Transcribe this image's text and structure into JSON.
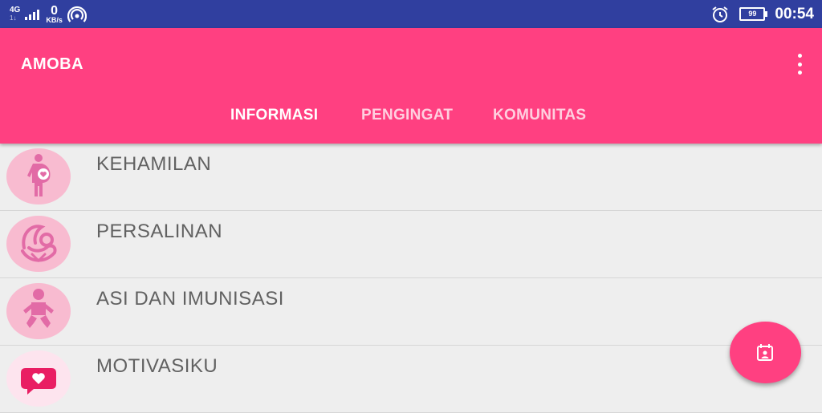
{
  "status_bar": {
    "network_type": "4G",
    "network_sub": "1↓",
    "speed_value": "0",
    "speed_unit": "KB/s",
    "battery": "99",
    "time": "00:54"
  },
  "app_bar": {
    "title": "AMOBA",
    "menu_icon": "more-vert-icon"
  },
  "tabs": [
    {
      "label": "INFORMASI",
      "active": true
    },
    {
      "label": "PENGINGAT",
      "active": false
    },
    {
      "label": "KOMUNITAS",
      "active": false
    }
  ],
  "list": [
    {
      "label": "KEHAMILAN",
      "icon": "pregnant-woman-icon"
    },
    {
      "label": "PERSALINAN",
      "icon": "mother-baby-icon"
    },
    {
      "label": "ASI DAN IMUNISASI",
      "icon": "baby-icon"
    },
    {
      "label": "MOTIVASIKU",
      "icon": "heart-chat-icon"
    }
  ],
  "fab": {
    "icon": "calendar-person-icon"
  },
  "colors": {
    "status_bar": "#303f9f",
    "accent": "#ff4081",
    "avatar_bg": "#f8bbd0",
    "icon_pink": "#e26ba6",
    "list_text": "#616161",
    "background": "#eeeeee"
  }
}
